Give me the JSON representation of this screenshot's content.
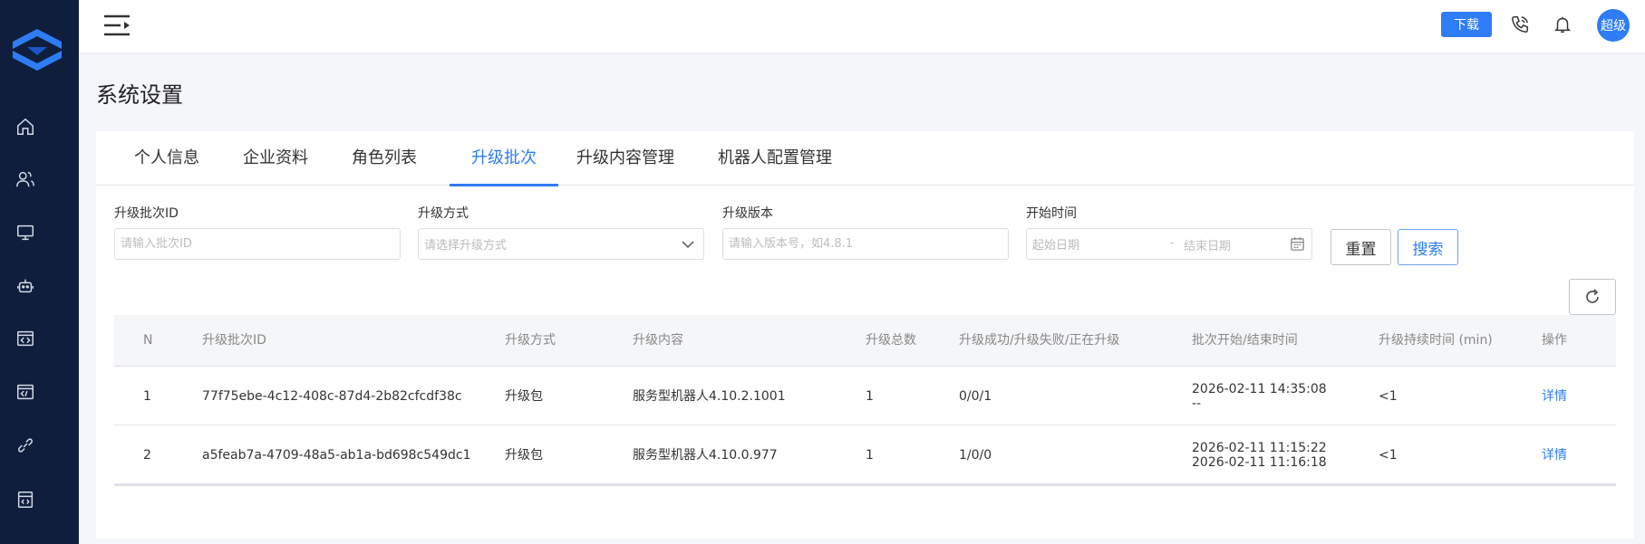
{
  "header": {
    "download_label": "下载",
    "avatar_text": "超级"
  },
  "page": {
    "title": "系统设置"
  },
  "tabs": [
    {
      "label": "个人信息"
    },
    {
      "label": "企业资料"
    },
    {
      "label": "角色列表"
    },
    {
      "label": "升级批次",
      "active": true
    },
    {
      "label": "升级内容管理"
    },
    {
      "label": "机器人配置管理"
    }
  ],
  "filters": {
    "batch_id": {
      "label": "升级批次ID",
      "placeholder": "请输入批次ID"
    },
    "method": {
      "label": "升级方式",
      "placeholder": "请选择升级方式"
    },
    "version": {
      "label": "升级版本",
      "placeholder": "请输入版本号，如4.8.1"
    },
    "time": {
      "label": "开始时间",
      "start_placeholder": "起始日期",
      "separator": "-",
      "end_placeholder": "结束日期"
    },
    "reset_label": "重置",
    "search_label": "搜索"
  },
  "table": {
    "columns": [
      "N",
      "升级批次ID",
      "升级方式",
      "升级内容",
      "升级总数",
      "升级成功/升级失败/正在升级",
      "批次开始/结束时间",
      "升级持续时间 (min)",
      "操作"
    ],
    "rows": [
      {
        "n": "1",
        "id": "77f75ebe-4c12-408c-87d4-2b82cfcdf38c",
        "method": "升级包",
        "content": "服务型机器人4.10.2.1001",
        "total": "1",
        "status": "0/0/1",
        "start": "2026-02-11 14:35:08",
        "end": "--",
        "duration": "<1",
        "action": "详情"
      },
      {
        "n": "2",
        "id": "a5feab7a-4709-48a5-ab1a-bd698c549dc1",
        "method": "升级包",
        "content": "服务型机器人4.10.0.977",
        "total": "1",
        "status": "1/0/0",
        "start": "2026-02-11 11:15:22",
        "end": "2026-02-11 11:16:18",
        "duration": "<1",
        "action": "详情"
      }
    ]
  },
  "colors": {
    "accent": "#2e7cf6",
    "sidebar": "#0f1e3d"
  }
}
